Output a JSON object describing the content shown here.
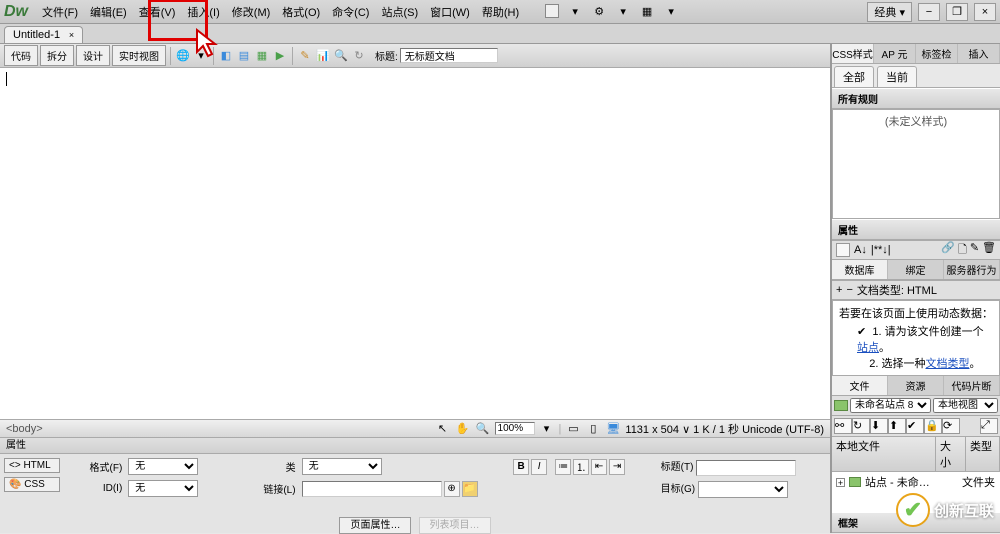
{
  "titlebar": {
    "logo": "Dw",
    "menus": [
      "文件(F)",
      "编辑(E)",
      "查看(V)",
      "插入(I)",
      "修改(M)",
      "格式(O)",
      "命令(C)",
      "站点(S)",
      "窗口(W)",
      "帮助(H)"
    ],
    "layout_label": "经典",
    "min": "−",
    "max": "❐",
    "close": "×"
  },
  "doc_tab": {
    "name": "Untitled-1",
    "close": "×"
  },
  "view_toolbar": {
    "buttons": [
      "代码",
      "拆分",
      "设计",
      "实时视图"
    ],
    "title_label": "标题:",
    "title_value": "无标题文档"
  },
  "status": {
    "tag": "<body>",
    "zoom": "100%",
    "info": "1131 x 504 ∨  1 K / 1 秒  Unicode (UTF-8)"
  },
  "properties": {
    "header": "属性",
    "tabs": [
      "<> HTML",
      "🎨 CSS"
    ],
    "labels": {
      "format": "格式(F)",
      "id": "ID(I)",
      "class": "类",
      "link": "链接(L)",
      "title": "标题(T)",
      "target": "目标(G)"
    },
    "values": {
      "format": "无",
      "id": "无",
      "class": "无",
      "link": "",
      "target": ""
    },
    "fmt_b": "B",
    "fmt_i": "I",
    "btn_page": "页面属性…",
    "btn_list": "列表项目…"
  },
  "panels": {
    "css": {
      "tabs": [
        "CSS样式",
        "AP 元",
        "标签检",
        "插入"
      ],
      "subtabs": [
        "全部",
        "当前"
      ],
      "rules_head": "所有规则",
      "rules_text": "(未定义样式)"
    },
    "attr": {
      "head": "属性"
    },
    "db": {
      "tabs": [
        "数据库",
        "绑定",
        "服务器行为"
      ],
      "line": "文档类型: HTML",
      "intro": "若要在该页面上使用动态数据：",
      "items_pre": [
        "1. 请为该文件创建一个",
        "2. 选择一种"
      ],
      "items_link": [
        "站点",
        "文档类型"
      ],
      "items_post": [
        "。",
        "。"
      ]
    },
    "files": {
      "tabs": [
        "文件",
        "资源",
        "代码片断"
      ],
      "site_dd": "未命名站点 8",
      "view_dd": "本地视图",
      "cols": [
        "本地文件",
        "大小",
        "类型"
      ],
      "row_name": "站点 - 未命…",
      "row_type": "文件夹"
    },
    "frame": {
      "head": "框架"
    }
  },
  "watermark": "创新互联"
}
